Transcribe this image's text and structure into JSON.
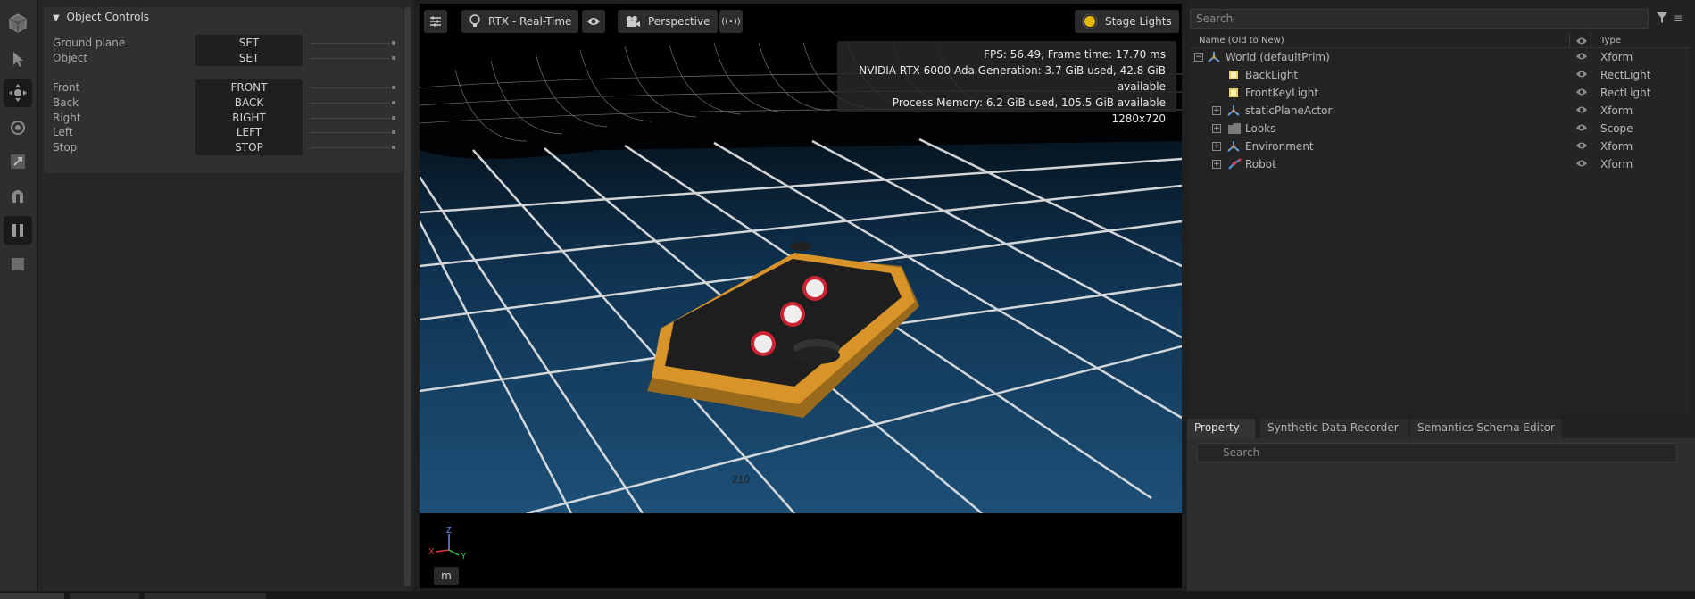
{
  "object_controls": {
    "title": "Object Controls",
    "rows": [
      {
        "label": "Ground plane",
        "button": "SET"
      },
      {
        "label": "Object",
        "button": "SET"
      },
      {
        "label": "Front",
        "button": "FRONT"
      },
      {
        "label": "Back",
        "button": "BACK"
      },
      {
        "label": "Right",
        "button": "RIGHT"
      },
      {
        "label": "Left",
        "button": "LEFT"
      },
      {
        "label": "Stop",
        "button": "STOP"
      }
    ]
  },
  "viewport": {
    "render_mode": "RTX - Real-Time",
    "camera": "Perspective",
    "lights": "Stage Lights",
    "stats": {
      "fps": "FPS: 56.49, Frame time: 17.70 ms",
      "gpu": "NVIDIA RTX 6000 Ada Generation: 3.7 GiB used, 42.8 GiB available",
      "memory": "Process Memory: 6.2 GiB used, 105.5 GiB available",
      "resolution": "1280x720"
    },
    "axis": {
      "z": "Z",
      "x": "X",
      "y": "Y"
    },
    "unit_button": "m",
    "robot_label": "210"
  },
  "stage": {
    "search_placeholder": "Search",
    "columns": {
      "name": "Name (Old to New)",
      "type": "Type"
    },
    "items": [
      {
        "name": "World (defaultPrim)",
        "type": "Xform",
        "indent": 0,
        "expander": "−",
        "icon": "xform-icon"
      },
      {
        "name": "BackLight",
        "type": "RectLight",
        "indent": 1,
        "expander": "",
        "icon": "rect-light-icon"
      },
      {
        "name": "FrontKeyLight",
        "type": "RectLight",
        "indent": 1,
        "expander": "",
        "icon": "rect-light-icon"
      },
      {
        "name": "staticPlaneActor",
        "type": "Xform",
        "indent": 1,
        "expander": "+",
        "icon": "xform-icon"
      },
      {
        "name": "Looks",
        "type": "Scope",
        "indent": 1,
        "expander": "+",
        "icon": "folder-icon"
      },
      {
        "name": "Environment",
        "type": "Xform",
        "indent": 1,
        "expander": "+",
        "icon": "xform-icon"
      },
      {
        "name": "Robot",
        "type": "Xform",
        "indent": 1,
        "expander": "+",
        "icon": "robot-icon"
      }
    ]
  },
  "property_panel": {
    "tabs": [
      "Property",
      "Synthetic Data Recorder",
      "Semantics Schema Editor"
    ],
    "active_tab": "Property",
    "search_placeholder": "Search"
  },
  "colors": {
    "accent": "#76b900",
    "floor": "#1b4a70",
    "robot": "#d8952a"
  }
}
